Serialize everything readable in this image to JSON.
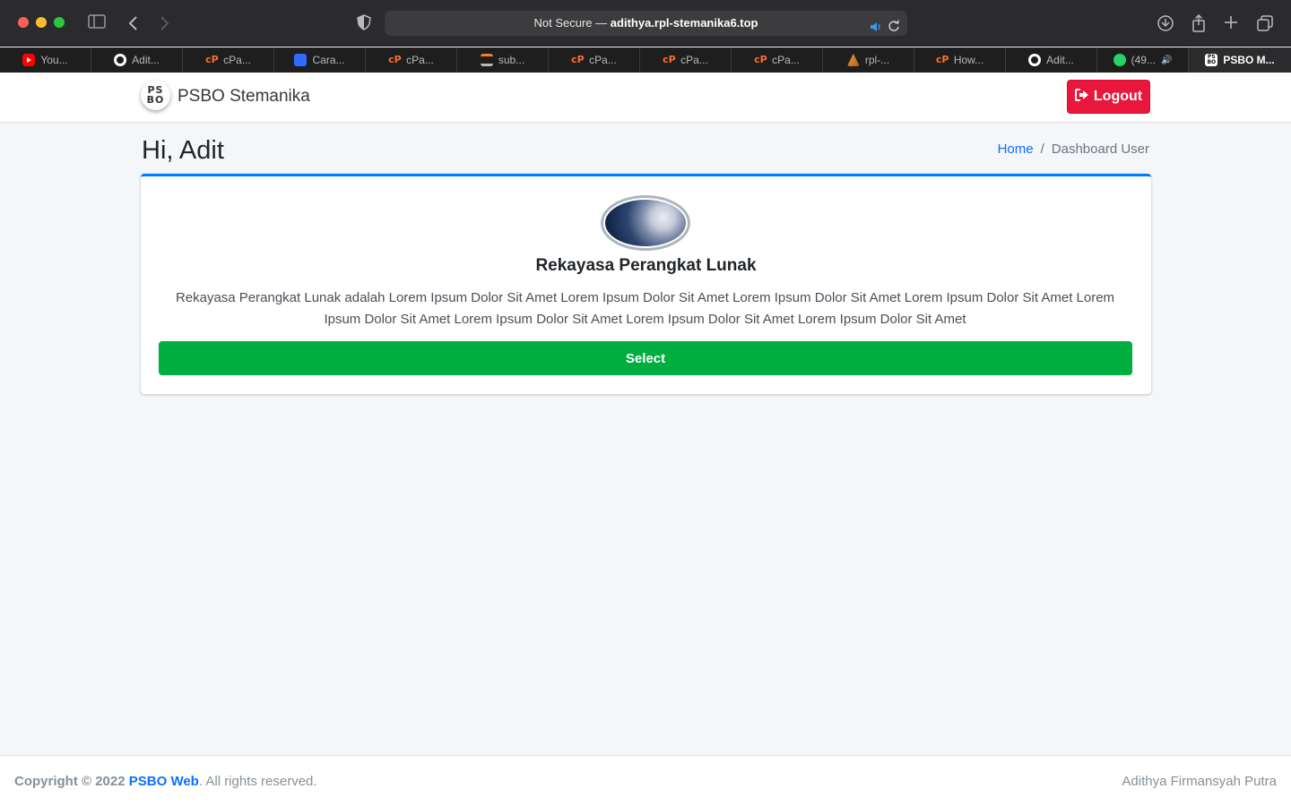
{
  "browser": {
    "address_prefix": "Not Secure —",
    "address_domain": "adithya.rpl-stemanika6.top",
    "tabs": [
      {
        "label": "You...",
        "icon": "youtube-icon"
      },
      {
        "label": "Adit...",
        "icon": "github-icon"
      },
      {
        "label": "cPa...",
        "icon": "cpanel-icon"
      },
      {
        "label": "Cara...",
        "icon": "cara-icon"
      },
      {
        "label": "cPa...",
        "icon": "cpanel-icon"
      },
      {
        "label": "sub...",
        "icon": "stackoverflow-icon"
      },
      {
        "label": "cPa...",
        "icon": "cpanel-icon"
      },
      {
        "label": "cPa...",
        "icon": "cpanel-icon"
      },
      {
        "label": "cPa...",
        "icon": "cpanel-icon"
      },
      {
        "label": "rpl-...",
        "icon": "rpl-icon"
      },
      {
        "label": "How...",
        "icon": "cpanel-icon"
      },
      {
        "label": "Adit...",
        "icon": "github-icon"
      },
      {
        "label": "(49...",
        "icon": "whatsapp-icon"
      },
      {
        "label": "PSBO M...",
        "icon": "psbo-icon"
      }
    ]
  },
  "navbar": {
    "brand_logo": "PS BO",
    "brand_name": "PSBO Stemanika",
    "logout_label": "Logout"
  },
  "page": {
    "greeting": "Hi, Adit",
    "breadcrumb_home": "Home",
    "breadcrumb_sep": "/",
    "breadcrumb_current": "Dashboard User"
  },
  "card": {
    "title": "Rekayasa Perangkat Lunak",
    "description": "Rekayasa Perangkat Lunak adalah Lorem Ipsum Dolor Sit Amet Lorem Ipsum Dolor Sit Amet Lorem Ipsum Dolor Sit Amet Lorem Ipsum Dolor Sit Amet Lorem Ipsum Dolor Sit Amet Lorem Ipsum Dolor Sit Amet Lorem Ipsum Dolor Sit Amet Lorem Ipsum Dolor Sit Amet",
    "select_label": "Select"
  },
  "footer": {
    "copyright": "Copyright © 2022",
    "brand_link": "PSBO Web",
    "rights": ". All rights reserved.",
    "author": "Adithya Firmansyah Putra"
  },
  "colors": {
    "accent_primary": "#007bff",
    "danger": "#e8173b",
    "success": "#00ad3f",
    "link": "#0d6efd"
  }
}
